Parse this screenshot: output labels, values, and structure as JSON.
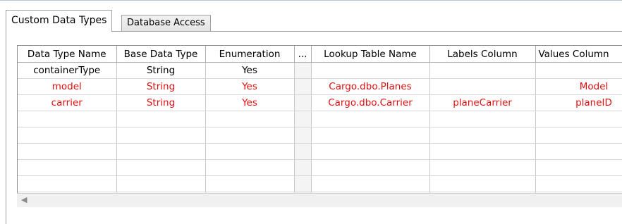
{
  "tabs": [
    {
      "label": "Custom Data Types",
      "active": true
    },
    {
      "label": "Database Access",
      "active": false
    }
  ],
  "grid": {
    "columns": [
      "Data Type Name",
      "Base Data Type",
      "Enumeration",
      "...",
      "Lookup Table Name",
      "Labels Column",
      "Values Column"
    ],
    "rows": [
      {
        "highlight": false,
        "cells": [
          "containerType",
          "String",
          "Yes",
          "",
          "",
          "",
          ""
        ]
      },
      {
        "highlight": true,
        "cells": [
          "model",
          "String",
          "Yes",
          "",
          "Cargo.dbo.Planes",
          "",
          "Model"
        ]
      },
      {
        "highlight": true,
        "cells": [
          "carrier",
          "String",
          "Yes",
          "",
          "Cargo.dbo.Carrier",
          "planeCarrier",
          "planeID"
        ]
      },
      {
        "highlight": false,
        "cells": [
          "",
          "",
          "",
          "",
          "",
          "",
          ""
        ]
      },
      {
        "highlight": false,
        "cells": [
          "",
          "",
          "",
          "",
          "",
          "",
          ""
        ]
      },
      {
        "highlight": false,
        "cells": [
          "",
          "",
          "",
          "",
          "",
          "",
          ""
        ]
      },
      {
        "highlight": false,
        "cells": [
          "",
          "",
          "",
          "",
          "",
          "",
          ""
        ]
      },
      {
        "highlight": false,
        "cells": [
          "",
          "",
          "",
          "",
          "",
          "",
          ""
        ]
      },
      {
        "highlight": false,
        "cells": [
          "",
          "",
          "",
          "",
          "",
          "",
          ""
        ]
      }
    ]
  },
  "colors": {
    "highlight_text": "#e01010"
  },
  "icons": {
    "scroll_left": "chevron-left-icon"
  }
}
